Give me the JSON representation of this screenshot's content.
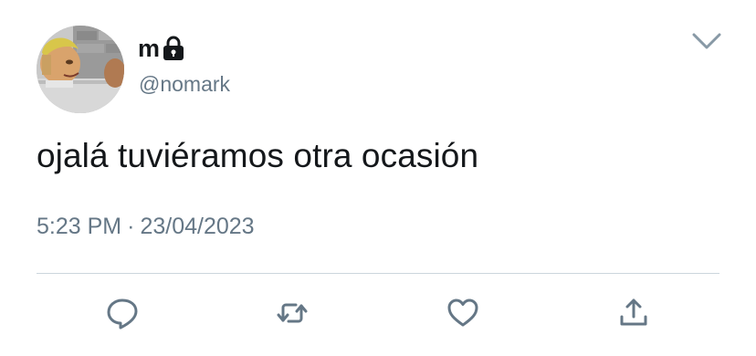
{
  "tweet": {
    "display_name": "m",
    "handle": "@nomark",
    "text": "ojalá tuviéramos otra ocasión",
    "time": "5:23 PM",
    "separator": "·",
    "date": "23/04/2023"
  },
  "icons": {
    "protected": "lock-icon",
    "menu": "chevron-down-icon",
    "reply": "comment-bubble-icon",
    "retweet": "retweet-arrows-icon",
    "like": "heart-icon",
    "share": "share-upload-icon"
  },
  "colors": {
    "text": "#14171a",
    "secondary": "#657786",
    "icon": "#657786",
    "divider": "#ccd6dd",
    "background": "#ffffff"
  }
}
